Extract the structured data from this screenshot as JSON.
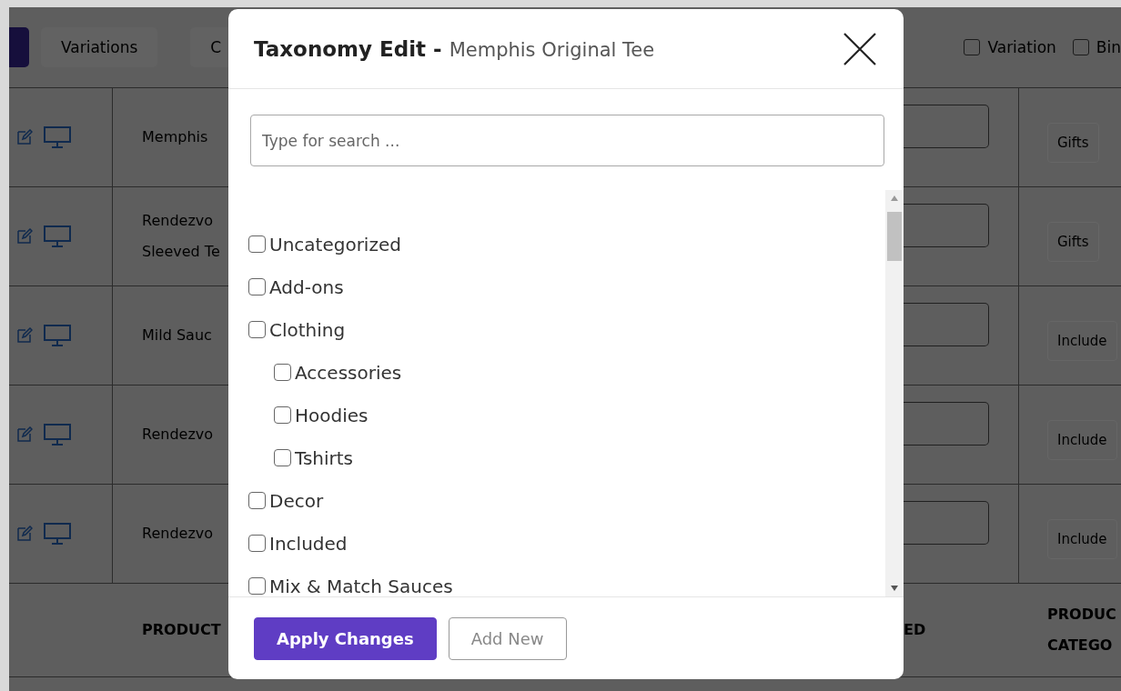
{
  "toolbar": {
    "buttons": [
      "Variations",
      "C"
    ],
    "filters": [
      {
        "label": "Variation",
        "checked": false
      },
      {
        "label": "Bin",
        "checked": false
      }
    ]
  },
  "rows": [
    {
      "name": [
        "Memphis"
      ],
      "tag": "Gifts"
    },
    {
      "name": [
        "Rendezvo",
        "Sleeved Te"
      ],
      "tag": "Gifts"
    },
    {
      "name": [
        "Mild Sauc"
      ],
      "tag": "Include"
    },
    {
      "name": [
        "Rendezvo"
      ],
      "tag": "Include"
    },
    {
      "name": [
        "Rendezvo"
      ],
      "tag": "Include"
    }
  ],
  "footer_header": {
    "column_2": "PRODUCT",
    "column_4": "ED",
    "column_5": [
      "PRODUC",
      "CATEGO"
    ]
  },
  "modal": {
    "title": "Taxonomy Edit -",
    "subtitle": "Memphis Original Tee",
    "search": {
      "placeholder": "Type for search ..."
    },
    "terms": [
      {
        "label": "Uncategorized",
        "checked": false
      },
      {
        "label": "Add-ons",
        "checked": false
      },
      {
        "label": "Clothing",
        "checked": false,
        "children": [
          {
            "label": "Accessories",
            "checked": false
          },
          {
            "label": "Hoodies",
            "checked": false
          },
          {
            "label": "Tshirts",
            "checked": false
          }
        ]
      },
      {
        "label": "Decor",
        "checked": false
      },
      {
        "label": "Included",
        "checked": false
      },
      {
        "label": "Mix & Match Sauces",
        "checked": false
      }
    ],
    "buttons": [
      {
        "label": "Apply Changes",
        "kind": "primary"
      },
      {
        "label": "Add New",
        "kind": "secondary"
      }
    ]
  }
}
